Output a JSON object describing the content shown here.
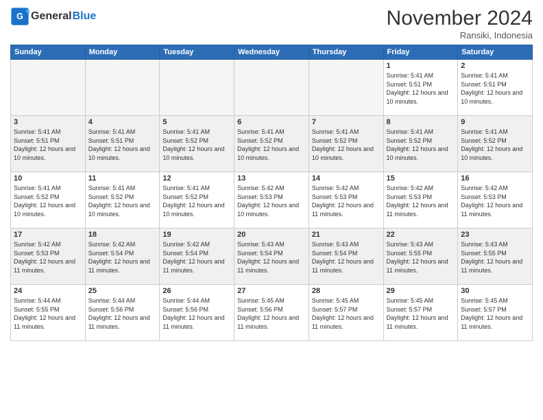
{
  "header": {
    "logo_line1": "General",
    "logo_line2": "Blue",
    "month": "November 2024",
    "location": "Ransiki, Indonesia"
  },
  "weekdays": [
    "Sunday",
    "Monday",
    "Tuesday",
    "Wednesday",
    "Thursday",
    "Friday",
    "Saturday"
  ],
  "weeks": [
    [
      {
        "day": "",
        "empty": true
      },
      {
        "day": "",
        "empty": true
      },
      {
        "day": "",
        "empty": true
      },
      {
        "day": "",
        "empty": true
      },
      {
        "day": "",
        "empty": true
      },
      {
        "day": "1",
        "sunrise": "5:41 AM",
        "sunset": "5:51 PM",
        "daylight": "12 hours and 10 minutes."
      },
      {
        "day": "2",
        "sunrise": "5:41 AM",
        "sunset": "5:51 PM",
        "daylight": "12 hours and 10 minutes."
      }
    ],
    [
      {
        "day": "3",
        "sunrise": "5:41 AM",
        "sunset": "5:51 PM",
        "daylight": "12 hours and 10 minutes."
      },
      {
        "day": "4",
        "sunrise": "5:41 AM",
        "sunset": "5:51 PM",
        "daylight": "12 hours and 10 minutes."
      },
      {
        "day": "5",
        "sunrise": "5:41 AM",
        "sunset": "5:52 PM",
        "daylight": "12 hours and 10 minutes."
      },
      {
        "day": "6",
        "sunrise": "5:41 AM",
        "sunset": "5:52 PM",
        "daylight": "12 hours and 10 minutes."
      },
      {
        "day": "7",
        "sunrise": "5:41 AM",
        "sunset": "5:52 PM",
        "daylight": "12 hours and 10 minutes."
      },
      {
        "day": "8",
        "sunrise": "5:41 AM",
        "sunset": "5:52 PM",
        "daylight": "12 hours and 10 minutes."
      },
      {
        "day": "9",
        "sunrise": "5:41 AM",
        "sunset": "5:52 PM",
        "daylight": "12 hours and 10 minutes."
      }
    ],
    [
      {
        "day": "10",
        "sunrise": "5:41 AM",
        "sunset": "5:52 PM",
        "daylight": "12 hours and 10 minutes."
      },
      {
        "day": "11",
        "sunrise": "5:41 AM",
        "sunset": "5:52 PM",
        "daylight": "12 hours and 10 minutes."
      },
      {
        "day": "12",
        "sunrise": "5:41 AM",
        "sunset": "5:52 PM",
        "daylight": "12 hours and 10 minutes."
      },
      {
        "day": "13",
        "sunrise": "5:42 AM",
        "sunset": "5:53 PM",
        "daylight": "12 hours and 10 minutes."
      },
      {
        "day": "14",
        "sunrise": "5:42 AM",
        "sunset": "5:53 PM",
        "daylight": "12 hours and 11 minutes."
      },
      {
        "day": "15",
        "sunrise": "5:42 AM",
        "sunset": "5:53 PM",
        "daylight": "12 hours and 11 minutes."
      },
      {
        "day": "16",
        "sunrise": "5:42 AM",
        "sunset": "5:53 PM",
        "daylight": "12 hours and 11 minutes."
      }
    ],
    [
      {
        "day": "17",
        "sunrise": "5:42 AM",
        "sunset": "5:53 PM",
        "daylight": "12 hours and 11 minutes."
      },
      {
        "day": "18",
        "sunrise": "5:42 AM",
        "sunset": "5:54 PM",
        "daylight": "12 hours and 11 minutes."
      },
      {
        "day": "19",
        "sunrise": "5:42 AM",
        "sunset": "5:54 PM",
        "daylight": "12 hours and 11 minutes."
      },
      {
        "day": "20",
        "sunrise": "5:43 AM",
        "sunset": "5:54 PM",
        "daylight": "12 hours and 11 minutes."
      },
      {
        "day": "21",
        "sunrise": "5:43 AM",
        "sunset": "5:54 PM",
        "daylight": "12 hours and 11 minutes."
      },
      {
        "day": "22",
        "sunrise": "5:43 AM",
        "sunset": "5:55 PM",
        "daylight": "12 hours and 11 minutes."
      },
      {
        "day": "23",
        "sunrise": "5:43 AM",
        "sunset": "5:55 PM",
        "daylight": "12 hours and 11 minutes."
      }
    ],
    [
      {
        "day": "24",
        "sunrise": "5:44 AM",
        "sunset": "5:55 PM",
        "daylight": "12 hours and 11 minutes."
      },
      {
        "day": "25",
        "sunrise": "5:44 AM",
        "sunset": "5:56 PM",
        "daylight": "12 hours and 11 minutes."
      },
      {
        "day": "26",
        "sunrise": "5:44 AM",
        "sunset": "5:56 PM",
        "daylight": "12 hours and 11 minutes."
      },
      {
        "day": "27",
        "sunrise": "5:45 AM",
        "sunset": "5:56 PM",
        "daylight": "12 hours and 11 minutes."
      },
      {
        "day": "28",
        "sunrise": "5:45 AM",
        "sunset": "5:57 PM",
        "daylight": "12 hours and 11 minutes."
      },
      {
        "day": "29",
        "sunrise": "5:45 AM",
        "sunset": "5:57 PM",
        "daylight": "12 hours and 11 minutes."
      },
      {
        "day": "30",
        "sunrise": "5:45 AM",
        "sunset": "5:57 PM",
        "daylight": "12 hours and 11 minutes."
      }
    ]
  ]
}
